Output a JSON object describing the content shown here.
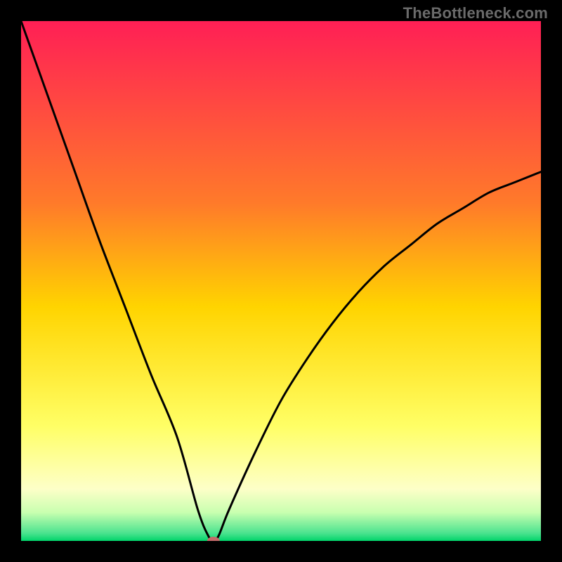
{
  "watermark": "TheBottleneck.com",
  "colors": {
    "top": "#ff1f55",
    "upper_mid": "#ff7a2a",
    "mid": "#ffd400",
    "lower_mid": "#ffff66",
    "pale_green": "#c9ffb0",
    "green": "#00d46a",
    "marker": "#c46a6a",
    "curve": "#000000",
    "frame": "#000000"
  },
  "chart_data": {
    "type": "line",
    "title": "",
    "xlabel": "",
    "ylabel": "",
    "xlim": [
      0,
      100
    ],
    "ylim": [
      0,
      100
    ],
    "series": [
      {
        "name": "bottleneck-curve",
        "x": [
          0,
          5,
          10,
          15,
          20,
          25,
          30,
          34,
          36,
          37,
          38,
          40,
          45,
          50,
          55,
          60,
          65,
          70,
          75,
          80,
          85,
          90,
          95,
          100
        ],
        "y": [
          100,
          86,
          72,
          58,
          45,
          32,
          20,
          6,
          1,
          0,
          1,
          6,
          17,
          27,
          35,
          42,
          48,
          53,
          57,
          61,
          64,
          67,
          69,
          71
        ]
      }
    ],
    "marker": {
      "x": 37,
      "y": 0
    },
    "gradient_stops": [
      {
        "offset": 0.0,
        "color": "#ff1f55"
      },
      {
        "offset": 0.35,
        "color": "#ff7a2a"
      },
      {
        "offset": 0.55,
        "color": "#ffd400"
      },
      {
        "offset": 0.78,
        "color": "#ffff66"
      },
      {
        "offset": 0.9,
        "color": "#fdffc8"
      },
      {
        "offset": 0.945,
        "color": "#c9ffb0"
      },
      {
        "offset": 0.985,
        "color": "#4be38f"
      },
      {
        "offset": 1.0,
        "color": "#00d46a"
      }
    ]
  }
}
